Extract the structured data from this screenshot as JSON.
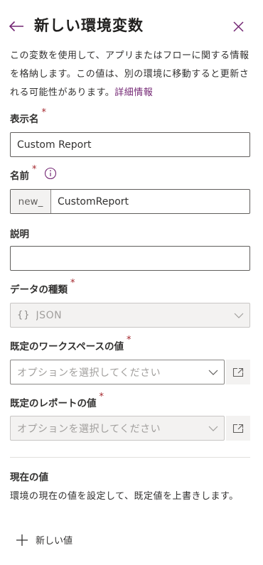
{
  "header": {
    "title": "新しい環境変数",
    "back_icon": "back-arrow-icon",
    "close_icon": "close-icon"
  },
  "description": {
    "text": "この変数を使用して、アプリまたはフローに関する情報を格納します。この値は、別の環境に移動すると更新される可能性があります。",
    "link": "詳細情報"
  },
  "fields": {
    "display_name": {
      "label": "表示名",
      "value": "Custom Report",
      "required": true
    },
    "name": {
      "label": "名前",
      "prefix": "new_",
      "value": "CustomReport",
      "required": true
    },
    "description": {
      "label": "説明",
      "value": ""
    },
    "data_type": {
      "label": "データの種類",
      "icon": "{}",
      "value": "JSON",
      "required": true
    },
    "default_workspace": {
      "label": "既定のワークスペースの値",
      "placeholder": "オプションを選択してください",
      "required": true
    },
    "default_report": {
      "label": "既定のレポートの値",
      "placeholder": "オプションを選択してください",
      "required": true
    }
  },
  "required_marker": "*",
  "current_value": {
    "title": "現在の値",
    "description": "環境の現在の値を設定して、既定値を上書きします。",
    "new_value_label": "新しい値"
  },
  "colors": {
    "accent": "#742774",
    "required": "#a4262c"
  }
}
